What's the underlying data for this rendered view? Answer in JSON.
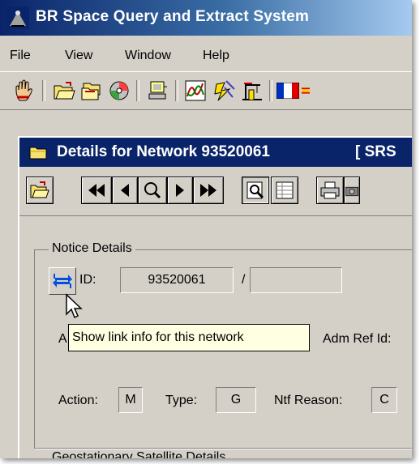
{
  "app": {
    "title": "BR Space Query and Extract System"
  },
  "menubar": {
    "items": [
      {
        "label": "File"
      },
      {
        "label": "View"
      },
      {
        "label": "Window"
      },
      {
        "label": "Help"
      }
    ]
  },
  "toolbar": {
    "icons": [
      "hand-icon",
      "open-folder-icon",
      "open-multiple-icon",
      "cd-icon",
      "computer-icon",
      "chart-icon",
      "lightning-icon",
      "crane-icon",
      "france-flag-icon",
      "spain-flag-icon"
    ]
  },
  "child_window": {
    "title": "Details for Network  93520061",
    "title_suffix": "[ SRS"
  },
  "notice": {
    "group_label": "Notice Details",
    "id_label": "ID:",
    "id_value": "93520061",
    "id_separator": "/",
    "id_value2": "",
    "partial_label": "A",
    "adm_ref_label": "Adm Ref Id:",
    "action_label": "Action:",
    "action_value": "M",
    "type_label": "Type:",
    "type_value": "G",
    "ntf_reason_label": "Ntf Reason:",
    "ntf_reason_value": "C"
  },
  "geo": {
    "group_label": "Geostationary Satellite Details"
  },
  "tooltip": {
    "text": "Show link info for this network"
  },
  "colors": {
    "title_bar": "#0a246a",
    "window_bg": "#d4d0c8",
    "tooltip_bg": "#ffffe1"
  }
}
